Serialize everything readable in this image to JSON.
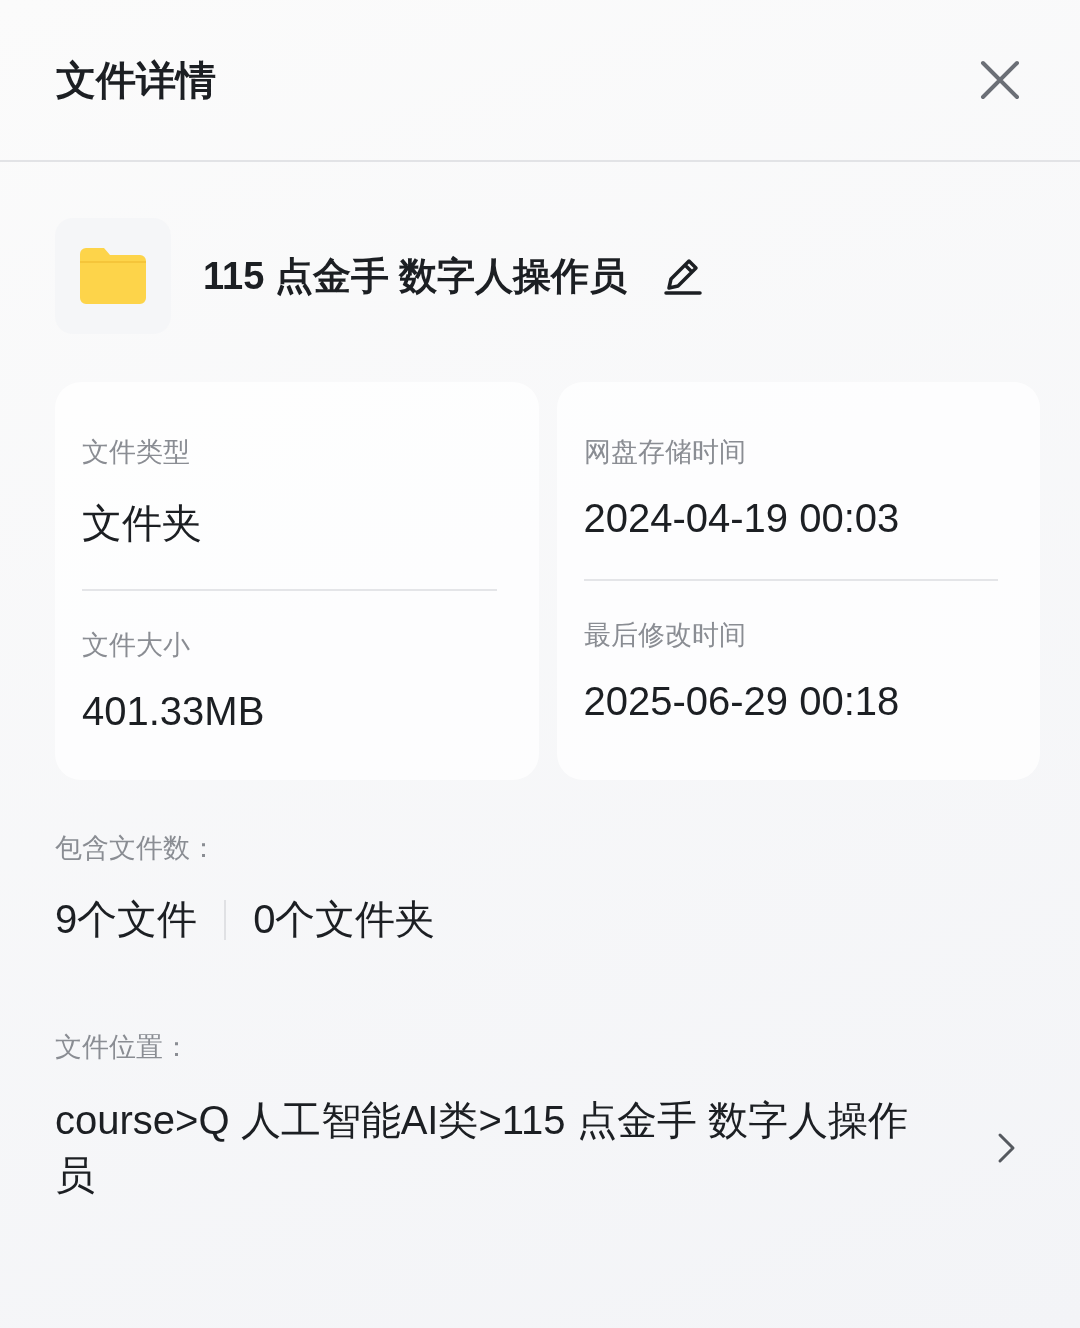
{
  "header": {
    "title": "文件详情"
  },
  "file": {
    "name": "115 点金手 数字人操作员"
  },
  "cards": [
    {
      "items": [
        {
          "label": "文件类型",
          "value": "文件夹"
        },
        {
          "label": "文件大小",
          "value": "401.33MB"
        }
      ]
    },
    {
      "items": [
        {
          "label": "网盘存储时间",
          "value": "2024-04-19 00:03"
        },
        {
          "label": "最后修改时间",
          "value": "2025-06-29 00:18"
        }
      ]
    }
  ],
  "contents": {
    "label": "包含文件数：",
    "counts": [
      "9个文件",
      "0个文件夹"
    ]
  },
  "location": {
    "label": "文件位置：",
    "path": "course>Q 人工智能AI类>115 点金手 数字人操作员"
  }
}
